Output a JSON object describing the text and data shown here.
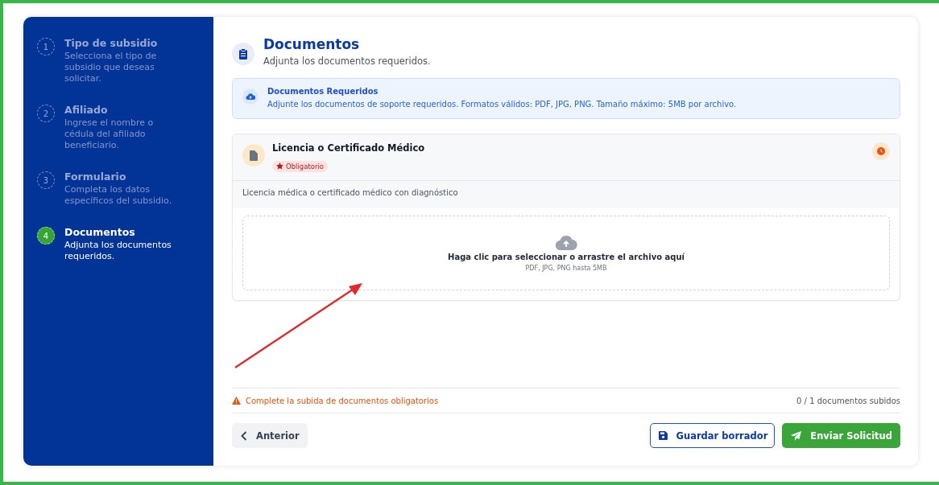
{
  "steps": [
    {
      "number": "1",
      "title": "Tipo de subsidio",
      "description": "Selecciona el tipo de subsidio que deseas solicitar.",
      "selected": false
    },
    {
      "number": "2",
      "title": "Afiliado",
      "description": "Ingrese el nombre o cédula del afiliado beneficiario.",
      "selected": false
    },
    {
      "number": "3",
      "title": "Formulario",
      "description": "Completa los datos específicos del subsidio.",
      "selected": false
    },
    {
      "number": "4",
      "title": "Documentos",
      "description": "Adjunta los documentos requeridos.",
      "selected": true
    }
  ],
  "header": {
    "title": "Documentos",
    "subtitle": "Adjunta los documentos requeridos."
  },
  "info": {
    "title": "Documentos Requeridos",
    "text": "Adjunte los documentos de soporte requeridos. Formatos válidos: PDF, JPG, PNG. Tamaño máximo: 5MB por archivo."
  },
  "documents": [
    {
      "title": "Licencia o Certificado Médico",
      "badge": "Obligatorio",
      "description": "Licencia médica o certificado médico con diagnóstico",
      "uploaded": false,
      "dropzone": {
        "text": "Haga clic para seleccionar o arrastre el archivo aquí",
        "hint": "PDF, JPG, PNG hasta 5MB"
      }
    }
  ],
  "status": {
    "warning": "Complete la subida de documentos obligatorios",
    "count": "0 / 1 documentos subidos"
  },
  "buttons": {
    "back": "Anterior",
    "save": "Guardar borrador",
    "submit": "Enviar Solicitud"
  },
  "annotation": {
    "kind": "arrow"
  }
}
